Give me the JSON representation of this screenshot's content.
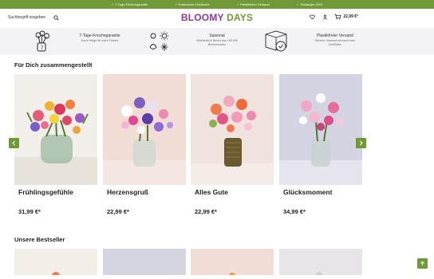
{
  "topbar": {
    "items": [
      "✓ 7-Tage-Frischegarantie",
      "✓ Kostenlose Grußkarte",
      "✓ Plastikfreier Versand",
      "✓ Testsieger 2024"
    ]
  },
  "header": {
    "search_placeholder": "Suchbegriff eingeben",
    "logo_part1": "BLOOMY",
    "logo_part2": "DAYS",
    "cart_total": "22,99 €*"
  },
  "usps": [
    {
      "title": "7-Tage-Frischegarantie",
      "sub": "Kurze Wege für mehr Frische",
      "icon": "flower-vase-icon"
    },
    {
      "title": "Saisonal",
      "sub": "Wöchentlich Neues aus 100.000 Blumensorten",
      "icon": "seasons-icon"
    },
    {
      "title": "Plastikfreier Versand",
      "sub": "Sicherer Versand mit kaum bzw. Cruiflickte.",
      "icon": "box-icon"
    }
  ],
  "sections": {
    "recommended_title": "Für Dich zusammengestellt",
    "bestseller_title": "Unsere Bestseller"
  },
  "products": [
    {
      "name": "Frühlingsgefühle",
      "price": "31,99 €*",
      "bg": "#f2efea"
    },
    {
      "name": "Herzensgruß",
      "price": "22,99 €*",
      "bg": "#f1dcd6"
    },
    {
      "name": "Alles Gute",
      "price": "22,99 €*",
      "bg": "#f0e2dc"
    },
    {
      "name": "Glücksmoment",
      "price": "34,99 €*",
      "bg": "#d4d3e2"
    }
  ],
  "bestsellers": [
    {
      "bg": "#f3eee6"
    },
    {
      "bg": "#d5d4e1"
    },
    {
      "bg": "#f2ddd6"
    },
    {
      "bg": "#e7e5e8"
    }
  ],
  "colors": {
    "brand_green": "#6f9a37",
    "brand_purple": "#8e3a94"
  }
}
